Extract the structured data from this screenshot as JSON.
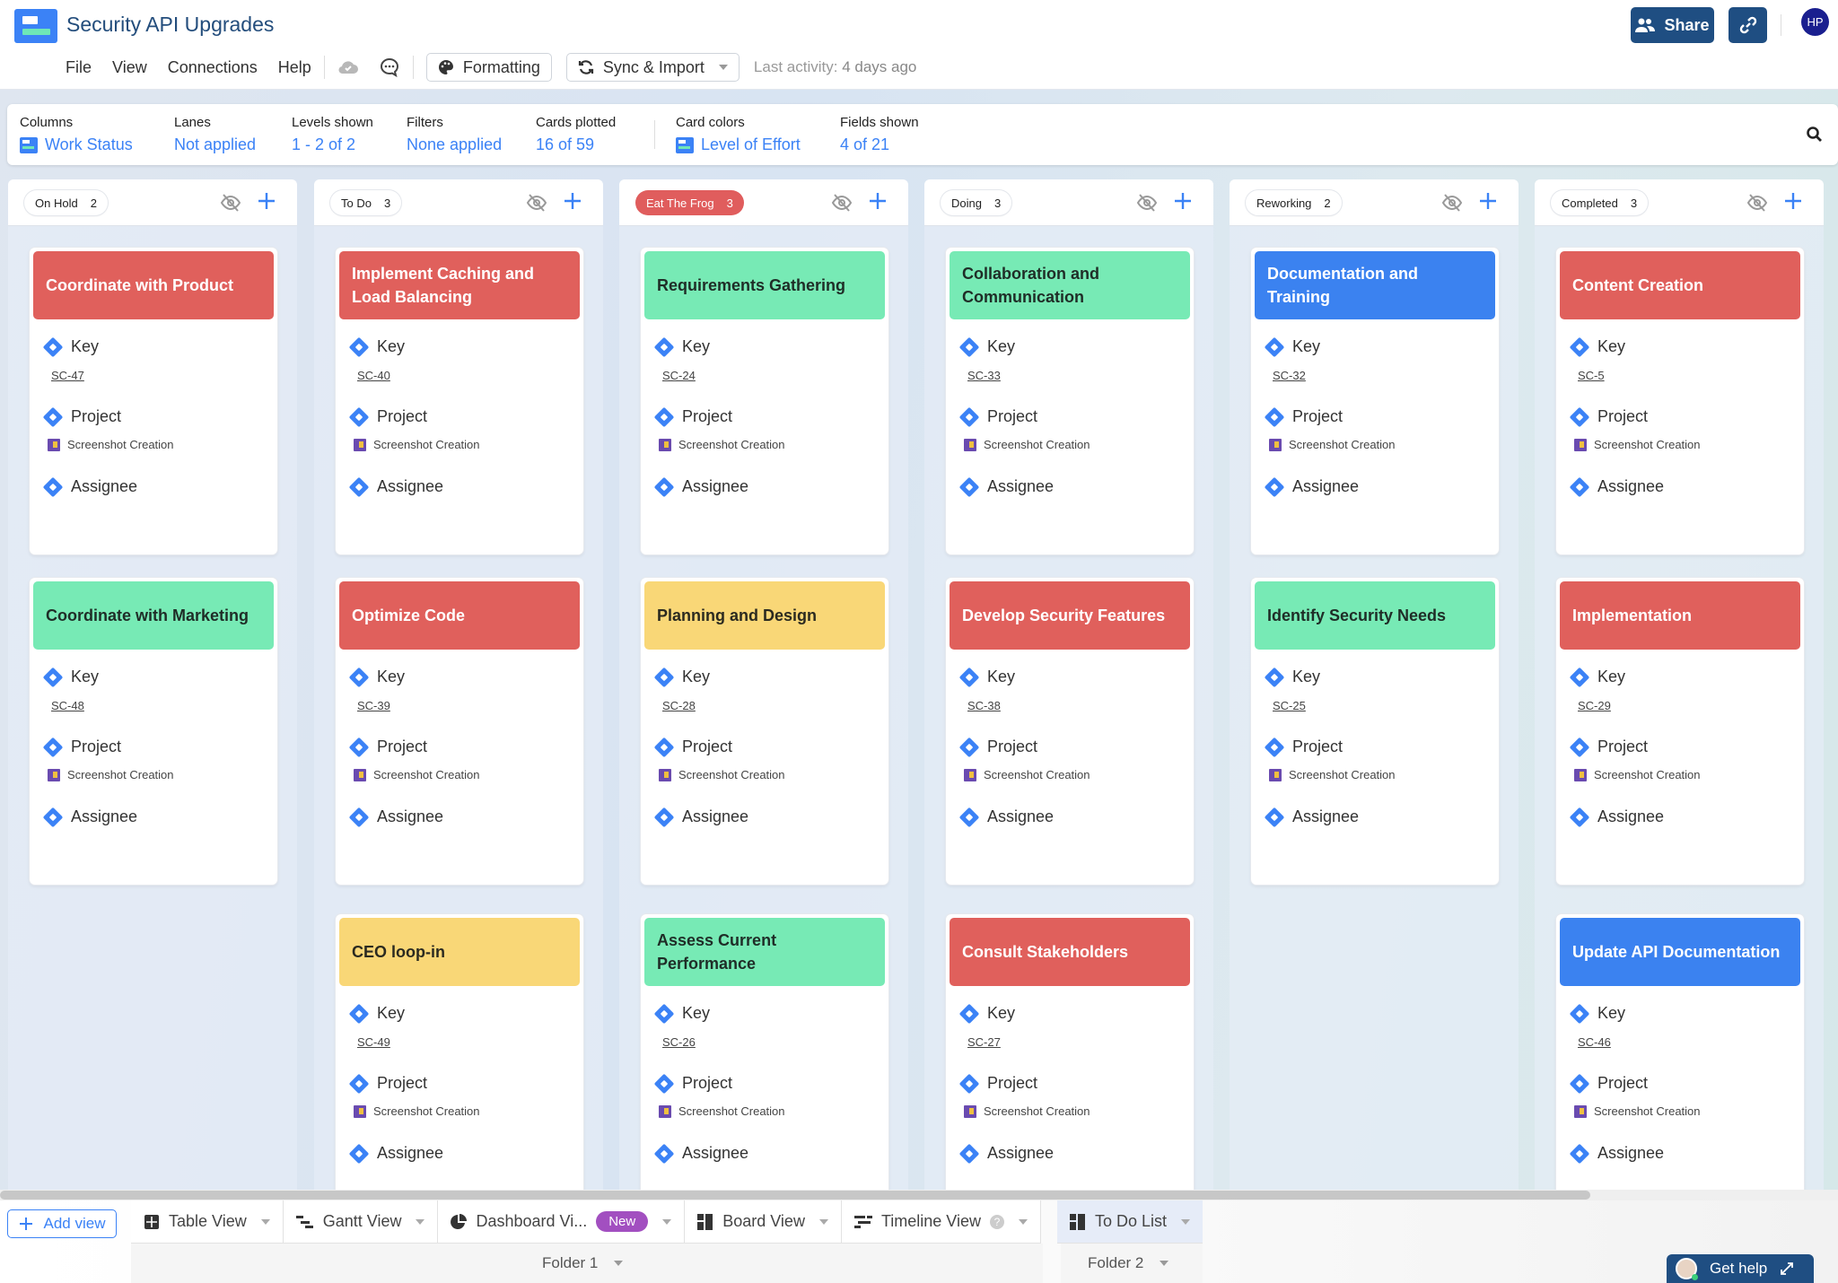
{
  "header": {
    "title": "Security API Upgrades",
    "menu": [
      "File",
      "View",
      "Connections",
      "Help"
    ],
    "formatting_label": "Formatting",
    "sync_label": "Sync & Import",
    "last_activity_label": "Last activity:",
    "last_activity_value": "4 days ago",
    "share_label": "Share",
    "avatar_initials": "HP"
  },
  "settings": {
    "columns": {
      "label": "Columns",
      "value": "Work Status"
    },
    "lanes": {
      "label": "Lanes",
      "value": "Not applied"
    },
    "levels": {
      "label": "Levels shown",
      "value": "1 - 2 of 2"
    },
    "filters": {
      "label": "Filters",
      "value": "None applied"
    },
    "cards_plotted": {
      "label": "Cards plotted",
      "value": "16 of 59"
    },
    "card_colors": {
      "label": "Card colors",
      "value": "Level of Effort"
    },
    "fields_shown": {
      "label": "Fields shown",
      "value": "4 of 21"
    }
  },
  "field_labels": {
    "key": "Key",
    "project": "Project",
    "assignee": "Assignee"
  },
  "columns": [
    {
      "name": "On Hold",
      "count": "2",
      "highlight": false,
      "cards": [
        {
          "title": "Coordinate with Product",
          "color": "red",
          "key": "SC-47",
          "project": "Screenshot Creation"
        },
        {
          "title": "Coordinate with Marketing",
          "color": "green",
          "key": "SC-48",
          "project": "Screenshot Creation"
        }
      ]
    },
    {
      "name": "To Do",
      "count": "3",
      "highlight": false,
      "cards": [
        {
          "title": "Implement Caching and Load Balancing",
          "color": "red",
          "key": "SC-40",
          "project": "Screenshot Creation"
        },
        {
          "title": "Optimize Code",
          "color": "red",
          "key": "SC-39",
          "project": "Screenshot Creation"
        },
        {
          "title": "CEO loop-in",
          "color": "yellow",
          "key": "SC-49",
          "project": "Screenshot Creation"
        }
      ]
    },
    {
      "name": "Eat The Frog",
      "count": "3",
      "highlight": true,
      "cards": [
        {
          "title": "Requirements Gathering",
          "color": "green",
          "key": "SC-24",
          "project": "Screenshot Creation"
        },
        {
          "title": "Planning and Design",
          "color": "yellow",
          "key": "SC-28",
          "project": "Screenshot Creation"
        },
        {
          "title": "Assess Current Performance",
          "color": "green",
          "key": "SC-26",
          "project": "Screenshot Creation"
        }
      ]
    },
    {
      "name": "Doing",
      "count": "3",
      "highlight": false,
      "cards": [
        {
          "title": "Collaboration and Communication",
          "color": "green",
          "key": "SC-33",
          "project": "Screenshot Creation"
        },
        {
          "title": "Develop Security Features",
          "color": "red",
          "key": "SC-38",
          "project": "Screenshot Creation"
        },
        {
          "title": "Consult Stakeholders",
          "color": "red",
          "key": "SC-27",
          "project": "Screenshot Creation"
        }
      ]
    },
    {
      "name": "Reworking",
      "count": "2",
      "highlight": false,
      "cards": [
        {
          "title": "Documentation and Training",
          "color": "blue",
          "key": "SC-32",
          "project": "Screenshot Creation"
        },
        {
          "title": "Identify Security Needs",
          "color": "green",
          "key": "SC-25",
          "project": "Screenshot Creation"
        }
      ]
    },
    {
      "name": "Completed",
      "count": "3",
      "highlight": false,
      "cards": [
        {
          "title": "Content Creation",
          "color": "red",
          "key": "SC-5",
          "project": "Screenshot Creation"
        },
        {
          "title": "Implementation",
          "color": "red",
          "key": "SC-29",
          "project": "Screenshot Creation"
        },
        {
          "title": "Update API Documentation",
          "color": "blue",
          "key": "SC-46",
          "project": "Screenshot Creation"
        }
      ]
    }
  ],
  "bottom": {
    "add_view": "Add view",
    "tabs": [
      {
        "label": "Table View",
        "icon": "table-icon"
      },
      {
        "label": "Gantt View",
        "icon": "gantt-icon"
      },
      {
        "label": "Dashboard Vi...",
        "icon": "pie-chart-icon",
        "badge": "New"
      },
      {
        "label": "Board View",
        "icon": "board-icon"
      },
      {
        "label": "Timeline View",
        "icon": "timeline-icon",
        "help": true
      }
    ],
    "active_tab": {
      "label": "To Do List",
      "icon": "board-icon"
    },
    "folder1": "Folder 1",
    "folder2": "Folder 2",
    "get_help": "Get help"
  },
  "colors": {
    "red": "#e0605c",
    "green": "#77eab5",
    "blue": "#3b82f0",
    "yellow": "#f9d777",
    "accent": "#3b82f6",
    "brand": "#1f4e82"
  }
}
